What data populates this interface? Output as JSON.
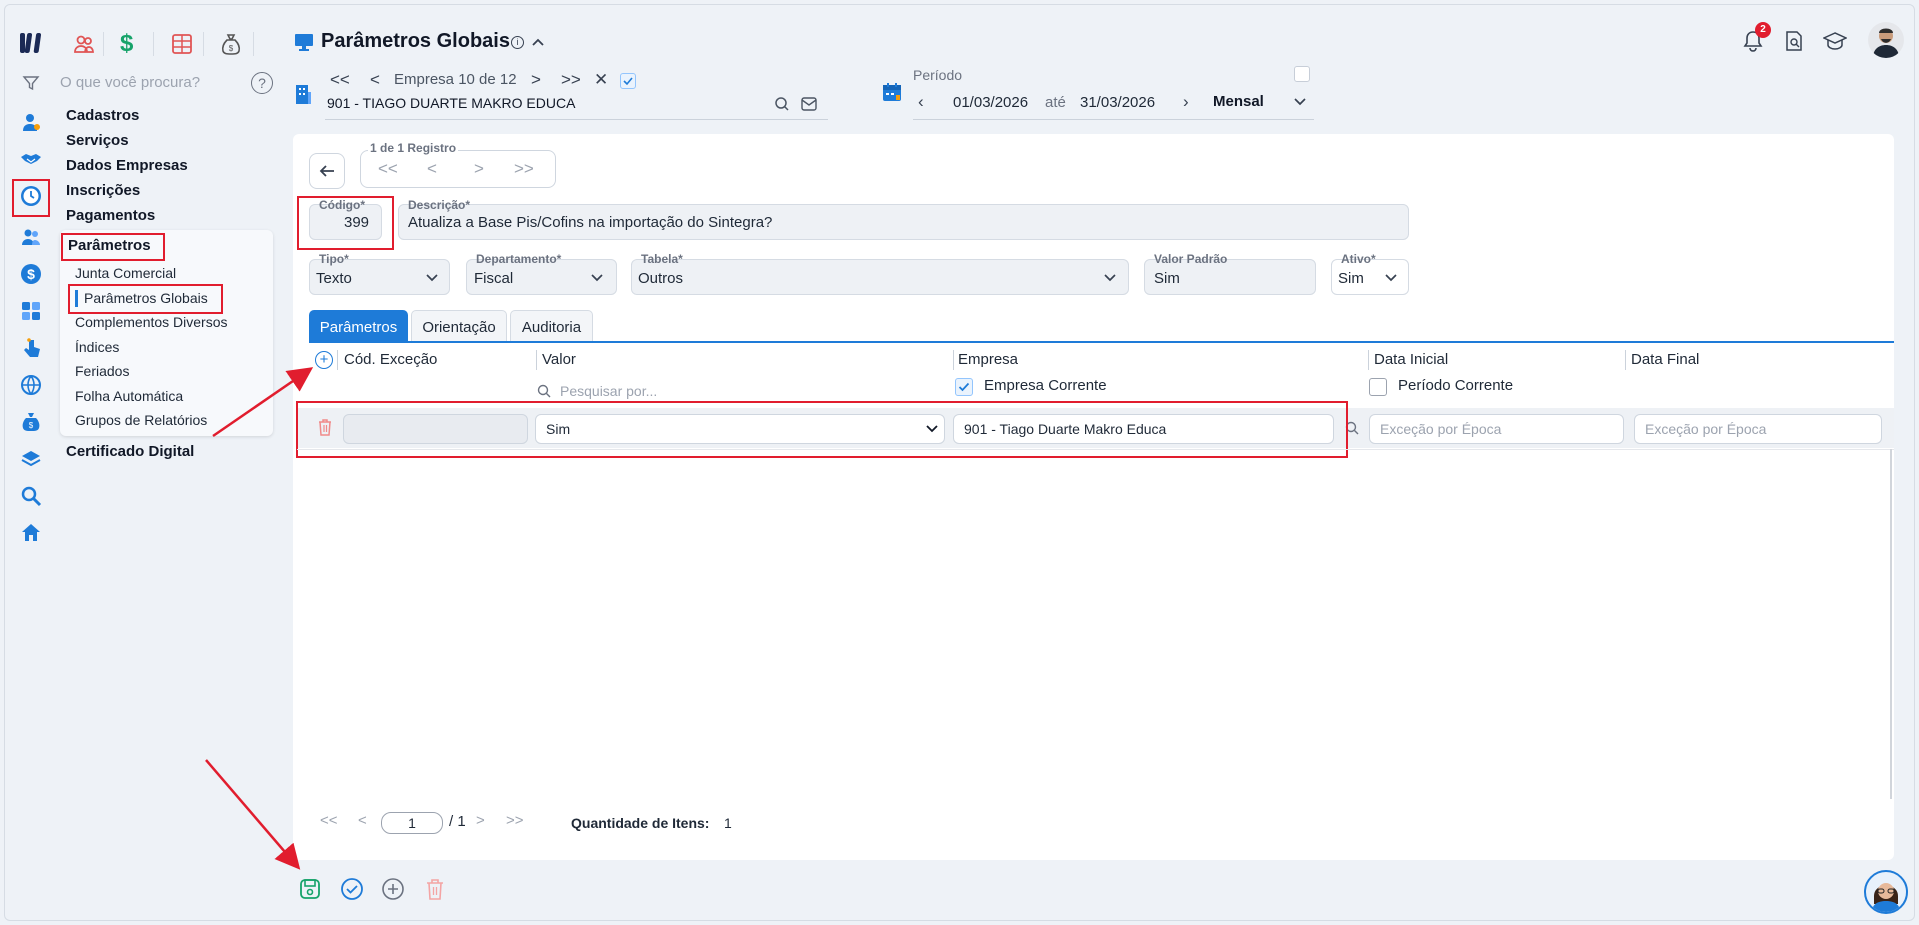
{
  "app": {
    "title": "Parâmetros Globais",
    "search_placeholder": "O que você procura?",
    "notification_count": "2"
  },
  "company_nav": {
    "first": "<<",
    "prev": "<",
    "label": "Empresa 10 de 12",
    "next": ">",
    "last": ">>",
    "close": "✕",
    "company": "901 - TIAGO DUARTE MAKRO EDUCA"
  },
  "period": {
    "label": "Período",
    "start": "01/03/2026",
    "until": "até",
    "end": "31/03/2026",
    "frequency": "Mensal"
  },
  "sidebar": {
    "menu": [
      {
        "label": "Cadastros"
      },
      {
        "label": "Serviços"
      },
      {
        "label": "Dados Empresas"
      },
      {
        "label": "Inscrições"
      },
      {
        "label": "Pagamentos"
      },
      {
        "label": "Parâmetros"
      },
      {
        "label": "Certificado Digital"
      }
    ],
    "submenu": [
      {
        "label": "Junta Comercial"
      },
      {
        "label": "Parâmetros Globais"
      },
      {
        "label": "Complementos Diversos"
      },
      {
        "label": "Índices"
      },
      {
        "label": "Feriados"
      },
      {
        "label": "Folha Automática"
      },
      {
        "label": "Grupos de Relatórios"
      }
    ]
  },
  "record_nav": {
    "label": "1 de 1 Registro",
    "first": "<<",
    "prev": "<",
    "next": ">",
    "last": ">>"
  },
  "form": {
    "codigo_label": "Código*",
    "codigo": "399",
    "descricao_label": "Descrição*",
    "descricao": "Atualiza a Base Pis/Cofins na importação do Sintegra?",
    "tipo_label": "Tipo*",
    "tipo": "Texto",
    "departamento_label": "Departamento*",
    "departamento": "Fiscal",
    "tabela_label": "Tabela*",
    "tabela": "Outros",
    "valor_padrao_label": "Valor Padrão",
    "valor_padrao": "Sim",
    "ativo_label": "Ativo*",
    "ativo": "Sim"
  },
  "tabs": [
    {
      "label": "Parâmetros",
      "active": true
    },
    {
      "label": "Orientação",
      "active": false
    },
    {
      "label": "Auditoria",
      "active": false
    }
  ],
  "grid": {
    "columns": [
      "Cód. Exceção",
      "Valor",
      "Empresa",
      "Data Inicial",
      "Data Final"
    ],
    "search_placeholder": "Pesquisar por...",
    "empresa_corrente": "Empresa Corrente",
    "periodo_corrente": "Período Corrente",
    "row": {
      "codigo": "",
      "valor": "Sim",
      "empresa": "901 - Tiago Duarte Makro Educa",
      "data_inicial_placeholder": "Exceção por Época",
      "data_final_placeholder": "Exceção por Época"
    }
  },
  "pagination": {
    "first": "<<",
    "prev": "<",
    "page": "1",
    "total": "/ 1",
    "next": ">",
    "last": ">>",
    "qty_label": "Quantidade de Itens:",
    "qty": "1"
  },
  "colors": {
    "accent": "#1e7bd8",
    "highlight": "#e11d2e",
    "save": "#16a36a"
  }
}
